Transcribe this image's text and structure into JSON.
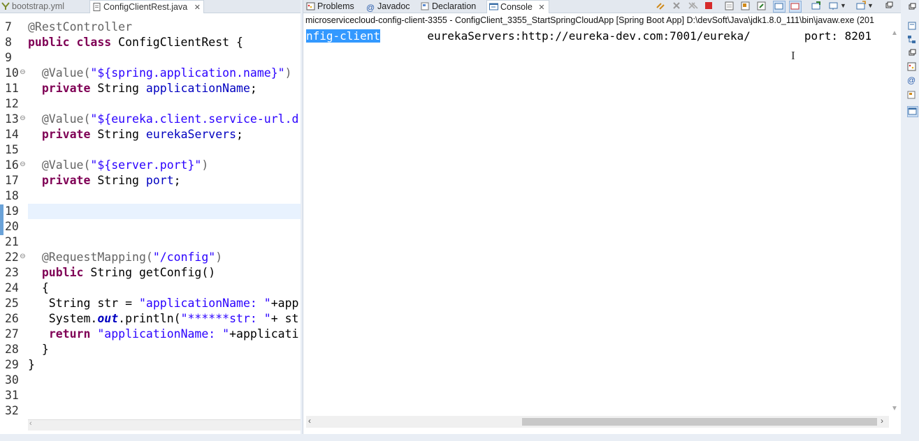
{
  "editor": {
    "tabs": [
      {
        "label": "bootstrap.yml",
        "active": false
      },
      {
        "label": "ConfigClientRest.java",
        "active": true,
        "close": "✕"
      }
    ],
    "line_numbers": [
      "7",
      "8",
      "9",
      "10",
      "11",
      "12",
      "13",
      "14",
      "15",
      "16",
      "17",
      "18",
      "19",
      "20",
      "21",
      "22",
      "23",
      "24",
      "25",
      "26",
      "27",
      "28",
      "29",
      "30",
      "31",
      "32"
    ],
    "fold_markers": [
      "⊖",
      "⊖",
      "⊖",
      "⊖"
    ]
  },
  "console": {
    "tabs": [
      {
        "label": "Problems",
        "active": false
      },
      {
        "label": "Javadoc",
        "active": false
      },
      {
        "label": "Declaration",
        "active": false
      },
      {
        "label": "Console",
        "active": true,
        "close": "✕"
      }
    ],
    "description": "microservicecloud-config-client-3355 - ConfigClient_3355_StartSpringCloudApp [Spring Boot App] D:\\devSoft\\Java\\jdk1.8.0_111\\bin\\javaw.exe (201",
    "output_selected": "nfig-client",
    "output_rest": "       eurekaServers:http://eureka-dev.com:7001/eureka/        port: 8201",
    "cursor": "I"
  },
  "colors": {
    "keyword": "#7f0055",
    "string": "#2a00ff",
    "annotation": "#646464",
    "field": "#0000c0",
    "selection": "#3399ff",
    "current_line": "#e8f2fe"
  },
  "icons": [
    "yaml-file-icon",
    "java-file-icon",
    "problems-icon",
    "javadoc-icon",
    "declaration-icon",
    "console-icon",
    "terminate-icon",
    "remove-launch-icon",
    "scroll-lock-icon",
    "pin-console-icon",
    "display-console-icon",
    "open-console-icon",
    "minimize-icon",
    "maximize-icon"
  ]
}
